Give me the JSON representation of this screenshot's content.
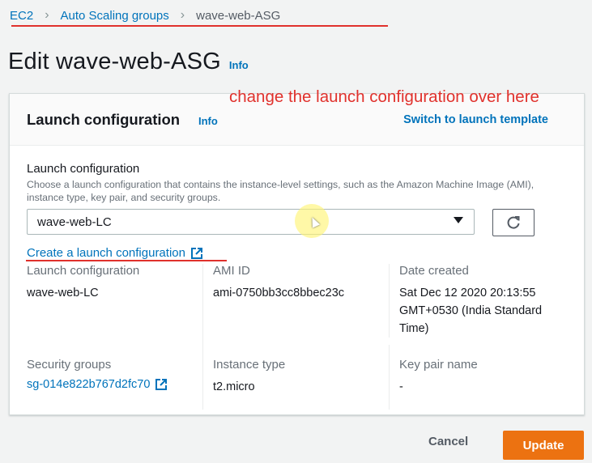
{
  "breadcrumb": {
    "items": [
      "EC2",
      "Auto Scaling groups",
      "wave-web-ASG"
    ]
  },
  "page": {
    "title": "Edit wave-web-ASG",
    "info": "Info"
  },
  "annotation": {
    "text": "change the launch configuration over here"
  },
  "panel": {
    "title": "Launch configuration",
    "info": "Info",
    "switch_link": "Switch to launch template",
    "field_label": "Launch configuration",
    "field_desc": "Choose a launch configuration that contains the instance-level settings, such as the Amazon Machine Image (AMI), instance type, key pair, and security groups.",
    "selected_value": "wave-web-LC",
    "create_link": "Create a launch configuration"
  },
  "details": {
    "launch_configuration": {
      "label": "Launch configuration",
      "value": "wave-web-LC"
    },
    "ami_id": {
      "label": "AMI ID",
      "value": "ami-0750bb3cc8bbec23c"
    },
    "date_created": {
      "label": "Date created",
      "value": "Sat Dec 12 2020 20:13:55 GMT+0530 (India Standard Time)"
    },
    "security_groups": {
      "label": "Security groups",
      "value": "sg-014e822b767d2fc70"
    },
    "instance_type": {
      "label": "Instance type",
      "value": "t2.micro"
    },
    "key_pair": {
      "label": "Key pair name",
      "value": "-"
    }
  },
  "footer": {
    "cancel": "Cancel",
    "update": "Update"
  },
  "colors": {
    "link": "#0073bb",
    "primary_button": "#ec7211",
    "annotation": "#e0312c"
  }
}
